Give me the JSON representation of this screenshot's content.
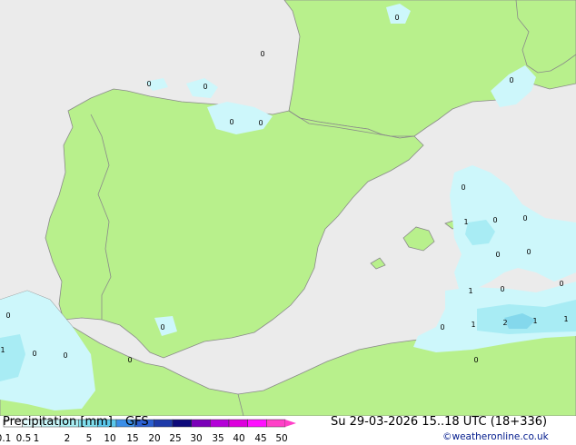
{
  "footer": {
    "title": "Precipitation [mm]",
    "model": "GFS",
    "datetime": "Su 29-03-2026 15..18 UTC (18+336)",
    "credit": "©weatheronline.co.uk"
  },
  "legend": {
    "levels": [
      "0.1",
      "0.5",
      "1",
      "2",
      "5",
      "10",
      "15",
      "20",
      "25",
      "30",
      "35",
      "40",
      "45",
      "50"
    ],
    "colors": [
      "#ffffff",
      "#e0fbfc",
      "#c7f6f9",
      "#a8eef3",
      "#80dfee",
      "#5bc8ec",
      "#3a8ee8",
      "#2b5fd1",
      "#1e3aa8",
      "#0d0a7a",
      "#7a00b8",
      "#b400d8",
      "#dd00dd",
      "#ff10ff",
      "#ff40c8"
    ]
  },
  "map": {
    "colors": {
      "sea": "#ebebeb",
      "land": "#b8f08c",
      "border": "#8a8a8a",
      "light_precip": "#cdf7fb",
      "mid_precip": "#a8ecf4",
      "heavy_precip": "#84d8ec"
    },
    "value_labels": [
      "0",
      "0",
      "0",
      "0",
      "0",
      "0",
      "0",
      "0",
      "0",
      "0",
      "1",
      "0",
      "0",
      "1",
      "0",
      "0",
      "0",
      "1",
      "2",
      "1",
      "1",
      "0",
      "0",
      "0",
      "0",
      "1",
      "0",
      "0"
    ]
  }
}
